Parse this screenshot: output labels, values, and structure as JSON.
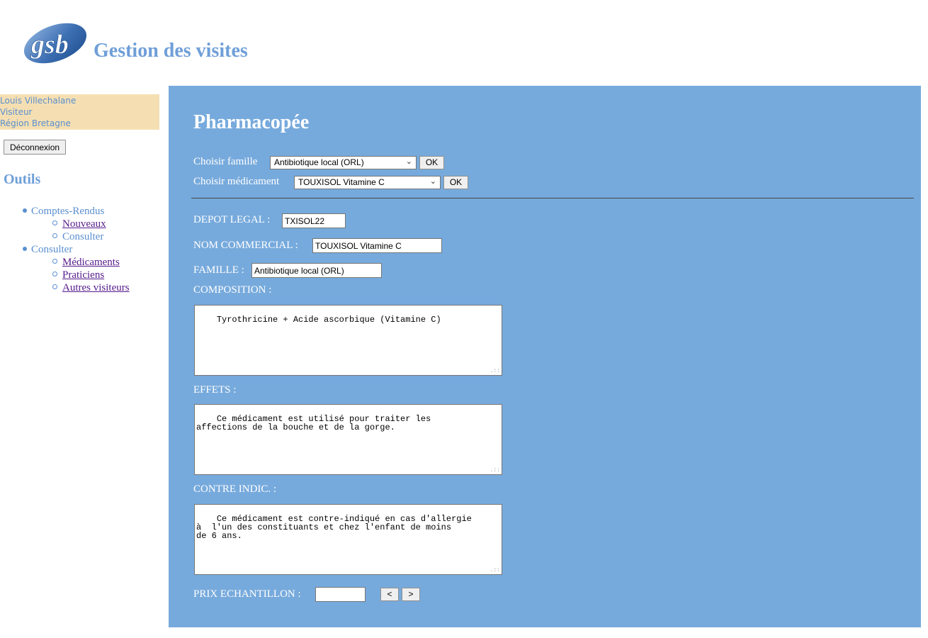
{
  "header": {
    "logo_text": "gsb",
    "title": "Gestion des visites"
  },
  "sidebar": {
    "user": {
      "name": "Louis Villechalane",
      "role": "Visiteur",
      "region": "Région Bretagne"
    },
    "logout_label": "Déconnexion",
    "tools_title": "Outils",
    "menu": [
      {
        "label": "Comptes-Rendus",
        "children": [
          {
            "label": "Nouveaux",
            "link": true
          },
          {
            "label": "Consulter",
            "link": false
          }
        ]
      },
      {
        "label": "Consulter",
        "children": [
          {
            "label": "Médicaments",
            "link": true
          },
          {
            "label": "Praticiens",
            "link": true
          },
          {
            "label": "Autres visiteurs",
            "link": true
          }
        ]
      }
    ]
  },
  "main": {
    "title": "Pharmacopée",
    "family_select": {
      "label": "Choisir famille",
      "value": "Antibiotique local (ORL)",
      "ok_label": "OK"
    },
    "drug_select": {
      "label": "Choisir médicament",
      "value": "TOUXISOL Vitamine C",
      "ok_label": "OK"
    },
    "fields": {
      "depot_legal": {
        "label": "DEPOT LEGAL :",
        "value": "TXISOL22"
      },
      "nom_commercial": {
        "label": "NOM COMMERCIAL :",
        "value": "TOUXISOL Vitamine C"
      },
      "famille": {
        "label": "FAMILLE :",
        "value": "Antibiotique local (ORL)"
      },
      "composition": {
        "label": "COMPOSITION :",
        "value": "Tyrothricine + Acide ascorbique (Vitamine C)"
      },
      "effets": {
        "label": "EFFETS :",
        "value": "Ce médicament est utilisé pour traiter les\naffections de la bouche et de la gorge."
      },
      "contre_indic": {
        "label": "CONTRE INDIC. :",
        "value": "Ce médicament est contre-indiqué en cas d'allergie\nà  l'un des constituants et chez l'enfant de moins\nde 6 ans."
      },
      "prix_echantillon": {
        "label": "PRIX ECHANTILLON :",
        "value": ""
      }
    },
    "nav": {
      "prev_label": "<",
      "next_label": ">"
    }
  },
  "colors": {
    "accent": "#6f9fd8",
    "panel": "#77aadc",
    "user_box": "#f5dfb2",
    "link_visited": "#551a8b"
  },
  "icons": {
    "logo": "gsb-logo-icon",
    "dropdown": "chevron-down-icon",
    "resize": "resize-grip-icon"
  }
}
